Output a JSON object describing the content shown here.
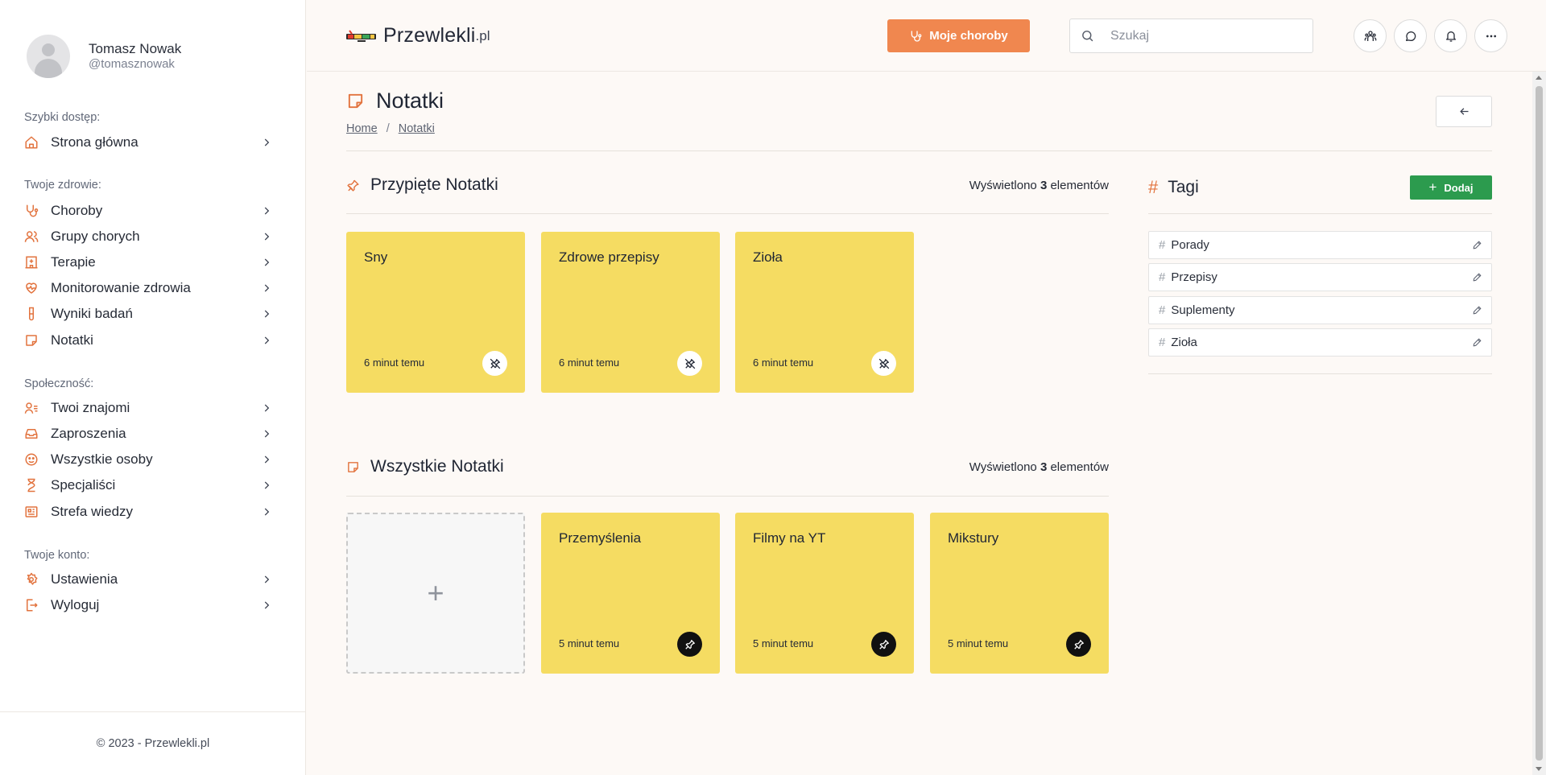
{
  "profile": {
    "name": "Tomasz Nowak",
    "handle": "@tomasznowak"
  },
  "sidebar": {
    "sections": [
      {
        "heading": "Szybki dostęp:",
        "items": [
          {
            "label": "Strona główna",
            "icon": "home-icon"
          }
        ]
      },
      {
        "heading": "Twoje zdrowie:",
        "items": [
          {
            "label": "Choroby",
            "icon": "stethoscope-icon"
          },
          {
            "label": "Grupy chorych",
            "icon": "users-icon"
          },
          {
            "label": "Terapie",
            "icon": "hospital-icon"
          },
          {
            "label": "Monitorowanie zdrowia",
            "icon": "heart-pulse-icon"
          },
          {
            "label": "Wyniki badań",
            "icon": "test-tube-icon"
          },
          {
            "label": "Notatki",
            "icon": "note-icon"
          }
        ]
      },
      {
        "heading": "Społeczność:",
        "items": [
          {
            "label": "Twoi znajomi",
            "icon": "user-list-icon"
          },
          {
            "label": "Zaproszenia",
            "icon": "inbox-icon"
          },
          {
            "label": "Wszystkie osoby",
            "icon": "smiley-icon"
          },
          {
            "label": "Specjaliści",
            "icon": "hourglass-icon"
          },
          {
            "label": "Strefa wiedzy",
            "icon": "newspaper-icon"
          }
        ]
      },
      {
        "heading": "Twoje konto:",
        "items": [
          {
            "label": "Ustawienia",
            "icon": "gear-icon"
          },
          {
            "label": "Wyloguj",
            "icon": "logout-icon"
          }
        ]
      }
    ],
    "footer": "© 2023 - Przewlekli.pl"
  },
  "header": {
    "logo_text": "Przewlekli",
    "logo_tld": ".pl",
    "primary_button": "Moje choroby",
    "search_placeholder": "Szukaj",
    "icon_buttons": [
      "community-icon",
      "chat-icon",
      "bell-icon",
      "more-icon"
    ]
  },
  "page": {
    "title": "Notatki",
    "breadcrumb": {
      "home": "Home",
      "separator": "/",
      "current": "Notatki"
    }
  },
  "pinned": {
    "title": "Przypięte Notatki",
    "count_prefix": "Wyświetlono",
    "count": "3",
    "count_suffix": "elementów",
    "notes": [
      {
        "title": "Sny",
        "time": "6 minut temu"
      },
      {
        "title": "Zdrowe przepisy",
        "time": "6 minut temu"
      },
      {
        "title": "Zioła",
        "time": "6 minut temu"
      }
    ]
  },
  "all_notes": {
    "title": "Wszystkie Notatki",
    "count_prefix": "Wyświetlono",
    "count": "3",
    "count_suffix": "elementów",
    "add_symbol": "+",
    "notes": [
      {
        "title": "Przemyślenia",
        "time": "5 minut temu"
      },
      {
        "title": "Filmy na YT",
        "time": "5 minut temu"
      },
      {
        "title": "Mikstury",
        "time": "5 minut temu"
      }
    ]
  },
  "tags": {
    "title": "Tagi",
    "hash": "#",
    "add_button": "Dodaj",
    "add_plus": "+",
    "items": [
      {
        "label": "Porady"
      },
      {
        "label": "Przepisy"
      },
      {
        "label": "Suplementy"
      },
      {
        "label": "Zioła"
      }
    ]
  },
  "colors": {
    "accent": "#f0874f",
    "icon_accent": "#e2733e",
    "note_yellow": "#f5dc62",
    "add_green": "#2c9b4e",
    "background": "#fdf9f6"
  }
}
